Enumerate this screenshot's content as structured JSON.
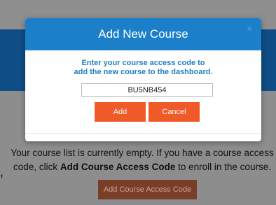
{
  "modal": {
    "title": "Add New Course",
    "close_glyph": "×",
    "prompt_line1": "Enter your course access code to",
    "prompt_line2": "add the new course to the dashboard.",
    "code_value": "BU5NB454",
    "add_label": "Add",
    "cancel_label": "Cancel"
  },
  "background": {
    "left_mark": ",",
    "empty_msg_part1": "Your course list is currently empty. If you have a course access code, click ",
    "empty_msg_bold": "Add Course Access Code",
    "empty_msg_part2": " to enroll in the course.",
    "add_code_button": "Add Course Access Code"
  },
  "colors": {
    "header": "#1b7fc9",
    "accent_button": "#f05a28",
    "prompt_text": "#1f7fc4",
    "banner": "#0e4d85"
  }
}
